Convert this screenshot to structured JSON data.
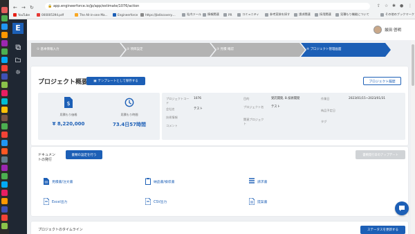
{
  "browser": {
    "url": "app.engineerforce.io/jp/app/estimate/1076/action",
    "bookmarks": [
      "YouTube",
      "000005394.pdf",
      "The All-in-one Ma...",
      "Engineerforce",
      "https://jbdiscovery....",
      "社内ツール",
      "情報関連",
      "PR",
      "コミュニティ",
      "参考実装を探す",
      "請求関連",
      "採用関連",
      "見積もり機能について"
    ],
    "other_bookmarks": "その他のブックマーク"
  },
  "app": {
    "logo": "E"
  },
  "user": {
    "name": "飯田 啓明"
  },
  "steps": [
    "① 基本情報入力",
    "② 項目設定",
    "③ 見積 確認",
    "④ プロジェクト管理画面"
  ],
  "overview": {
    "title": "プロジェクト概要",
    "save_template": "テンプレートとして保存する",
    "history": "プロジェクト履歴",
    "metrics": [
      {
        "label": "見積もり価格",
        "value": "¥ 8,220,000"
      },
      {
        "label": "見積もり時間",
        "value": "73.4日57時間"
      }
    ],
    "details": {
      "code_label": "プロジェクトコード",
      "code_value": "1076",
      "company_label": "会社名",
      "company_value": "テスト",
      "tech_label": "技術情報",
      "tech_value": "",
      "comment_label": "コメント",
      "comment_value": "",
      "purpose_label": "目的",
      "purpose_value": "受託開発, B.技術開発",
      "project_name_label": "プロジェクト名",
      "project_name_value": "テスト",
      "related_label": "関連プロジェクト",
      "related_value": "",
      "period_label": "作業日",
      "period_value": "2023/01/15~2023/01/31",
      "estimate_date_label": "納品予定日",
      "estimate_date_value": "",
      "tag_label": "タグ",
      "tag_value": ""
    }
  },
  "documents": {
    "label_line1": "ドキュメン",
    "label_line2": "トの発行",
    "settings_button": "書類の設定を行う",
    "update_button": "書類発行日のアップデート",
    "items": [
      "見積書/注文書",
      "納品書/検収書",
      "請求書",
      "Excel出力",
      "CSV出力",
      "提案書"
    ]
  },
  "timeline": {
    "title": "プロジェクトのタイムライン",
    "update_status": "ステータスを更新する"
  },
  "colors": {
    "accent": "#1c5fb6",
    "step_inactive": "#b3b3b3",
    "sidebar": "#1f2733"
  }
}
